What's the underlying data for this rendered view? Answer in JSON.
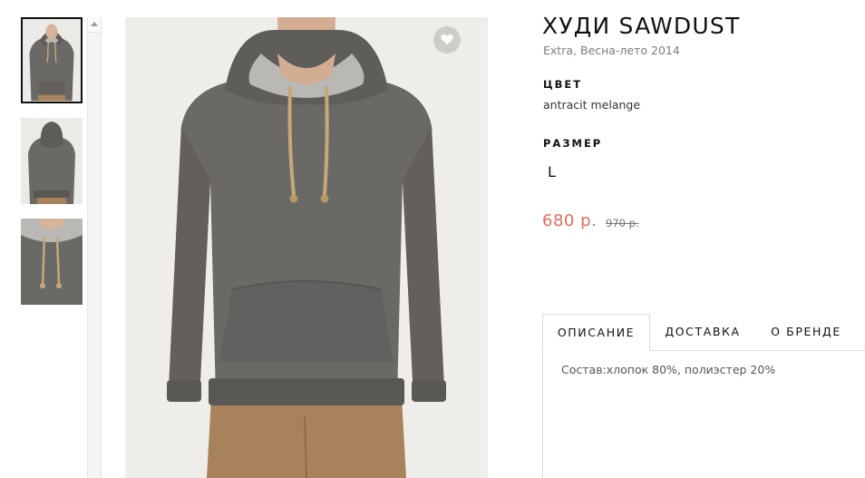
{
  "product": {
    "title": "ХУДИ SAWDUST",
    "subtitle": "Extra, Весна-лето 2014",
    "color_label": "ЦВЕТ",
    "color_value": "antracit melange",
    "size_label": "РАЗМЕР",
    "size_options": [
      "L"
    ],
    "price": "680 р.",
    "old_price": "970 р."
  },
  "tabs": [
    {
      "label": "ОПИСАНИЕ"
    },
    {
      "label": "ДОСТАВКА"
    },
    {
      "label": "О БРЕНДЕ"
    }
  ],
  "description": {
    "text": "Состав:хлопок 80%, полиэстер 20%"
  },
  "colors": {
    "accent_price": "#e26a60",
    "hoodie": "#6b6966",
    "hood_lining": "#b9b8b5",
    "drawstring": "#c6a878",
    "pants": "#a8825a"
  },
  "icons": {
    "favorite": "heart-icon",
    "scroll_up": "chevron-up-icon"
  }
}
